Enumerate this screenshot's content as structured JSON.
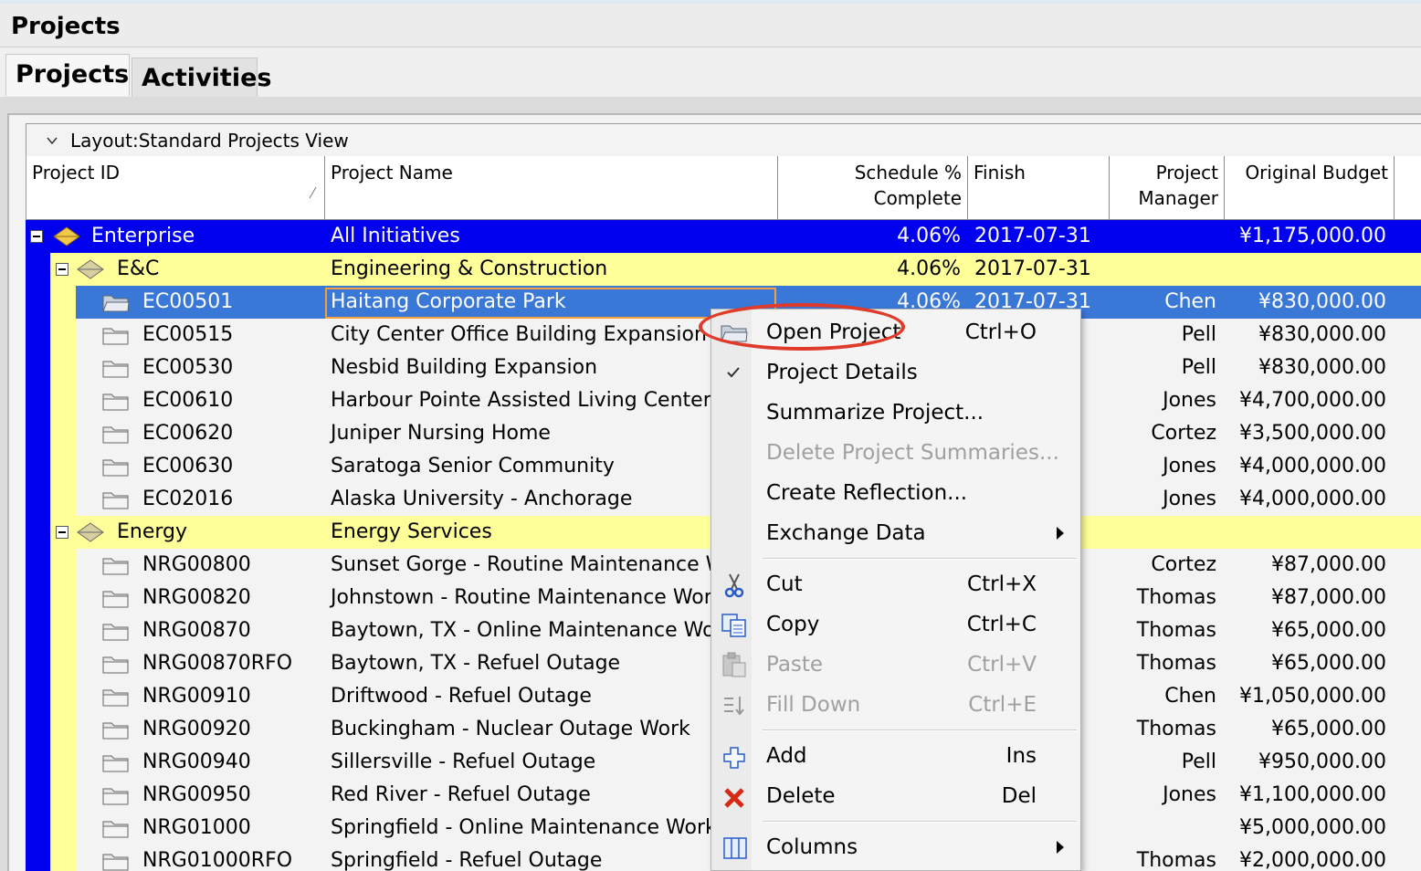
{
  "window": {
    "title": "Projects"
  },
  "tabs": [
    {
      "label": "Projects"
    },
    {
      "label": "Activities"
    }
  ],
  "layout": {
    "label": "Layout:Standard Projects View"
  },
  "columns": {
    "project_id": "Project ID",
    "project_name": "Project Name",
    "schedule_line1": "Schedule %",
    "schedule_line2": "Complete",
    "finish": "Finish",
    "pm_line1": "Project",
    "pm_line2": "Manager",
    "budget": "Original Budget"
  },
  "rows": [
    {
      "id": "Enterprise",
      "name": "All  Initiatives",
      "pct": "4.06%",
      "finish": "2017-07-31",
      "pm": "",
      "budget": "¥1,175,000.00"
    },
    {
      "id": "E&C",
      "name": "Engineering & Construction",
      "pct": "4.06%",
      "finish": "2017-07-31",
      "pm": "",
      "budget": ""
    },
    {
      "id": "EC00501",
      "name": "Haitang Corporate Park",
      "pct": "4.06%",
      "finish": "2017-07-31",
      "pm": "Chen",
      "budget": "¥830,000.00"
    },
    {
      "id": "EC00515",
      "name": "City Center Office Building Expansion",
      "pct": "",
      "finish": "",
      "pm": "Pell",
      "budget": "¥830,000.00"
    },
    {
      "id": "EC00530",
      "name": "Nesbid Building Expansion",
      "pct": "",
      "finish": "",
      "pm": "Pell",
      "budget": "¥830,000.00"
    },
    {
      "id": "EC00610",
      "name": "Harbour Pointe Assisted Living Center",
      "pct": "",
      "finish": "",
      "pm": "Jones",
      "budget": "¥4,700,000.00"
    },
    {
      "id": "EC00620",
      "name": "Juniper Nursing Home",
      "pct": "",
      "finish": "",
      "pm": "Cortez",
      "budget": "¥3,500,000.00"
    },
    {
      "id": "EC00630",
      "name": "Saratoga Senior Community",
      "pct": "",
      "finish": "",
      "pm": "Jones",
      "budget": "¥4,000,000.00"
    },
    {
      "id": "EC02016",
      "name": "Alaska University - Anchorage",
      "pct": "",
      "finish": "",
      "pm": "Jones",
      "budget": "¥4,000,000.00"
    },
    {
      "id": "Energy",
      "name": "Energy Services",
      "pct": "",
      "finish": "",
      "pm": "",
      "budget": ""
    },
    {
      "id": "NRG00800",
      "name": "Sunset Gorge - Routine Maintenance Work",
      "pct": "",
      "finish": "",
      "pm": "Cortez",
      "budget": "¥87,000.00"
    },
    {
      "id": "NRG00820",
      "name": "Johnstown - Routine Maintenance Work",
      "pct": "",
      "finish": "",
      "pm": "Thomas",
      "budget": "¥87,000.00"
    },
    {
      "id": "NRG00870",
      "name": "Baytown, TX - Online Maintenance Work",
      "pct": "",
      "finish": "",
      "pm": "Thomas",
      "budget": "¥65,000.00"
    },
    {
      "id": "NRG00870RFO",
      "name": "Baytown, TX - Refuel Outage",
      "pct": "",
      "finish": "",
      "pm": "Thomas",
      "budget": "¥65,000.00"
    },
    {
      "id": "NRG00910",
      "name": "Driftwood - Refuel Outage",
      "pct": "",
      "finish": "",
      "pm": "Chen",
      "budget": "¥1,050,000.00"
    },
    {
      "id": "NRG00920",
      "name": "Buckingham - Nuclear Outage Work",
      "pct": "",
      "finish": "",
      "pm": "Thomas",
      "budget": "¥65,000.00"
    },
    {
      "id": "NRG00940",
      "name": "Sillersville - Refuel Outage",
      "pct": "",
      "finish": "",
      "pm": "Pell",
      "budget": "¥950,000.00"
    },
    {
      "id": "NRG00950",
      "name": "Red River - Refuel Outage",
      "pct": "",
      "finish": "",
      "pm": "Jones",
      "budget": "¥1,100,000.00"
    },
    {
      "id": "NRG01000",
      "name": "Springfield - Online Maintenance Work",
      "pct": "",
      "finish": "",
      "pm": "",
      "budget": "¥5,000,000.00"
    },
    {
      "id": "NRG01000RFO",
      "name": "Springfield - Refuel Outage",
      "pct": "",
      "finish": "",
      "pm": "Thomas",
      "budget": "¥2,000,000.00"
    }
  ],
  "context_menu": {
    "open_project": {
      "label": "Open Project",
      "shortcut": "Ctrl+O"
    },
    "project_details": {
      "label": "Project Details"
    },
    "summarize": {
      "label": "Summarize Project..."
    },
    "delete_summaries": {
      "label": "Delete Project Summaries..."
    },
    "create_reflection": {
      "label": "Create Reflection..."
    },
    "exchange_data": {
      "label": "Exchange Data"
    },
    "cut": {
      "label": "Cut",
      "shortcut": "Ctrl+X"
    },
    "copy": {
      "label": "Copy",
      "shortcut": "Ctrl+C"
    },
    "paste": {
      "label": "Paste",
      "shortcut": "Ctrl+V"
    },
    "fill_down": {
      "label": "Fill Down",
      "shortcut": "Ctrl+E"
    },
    "add": {
      "label": "Add",
      "shortcut": "Ins"
    },
    "delete": {
      "label": "Delete",
      "shortcut": "Del"
    },
    "columns": {
      "label": "Columns"
    }
  },
  "colors": {
    "enterprise_row": "#0000ee",
    "group_row": "#ffff99",
    "selected_row": "#3a78d8",
    "highlight_oval": "#e03a2a"
  }
}
